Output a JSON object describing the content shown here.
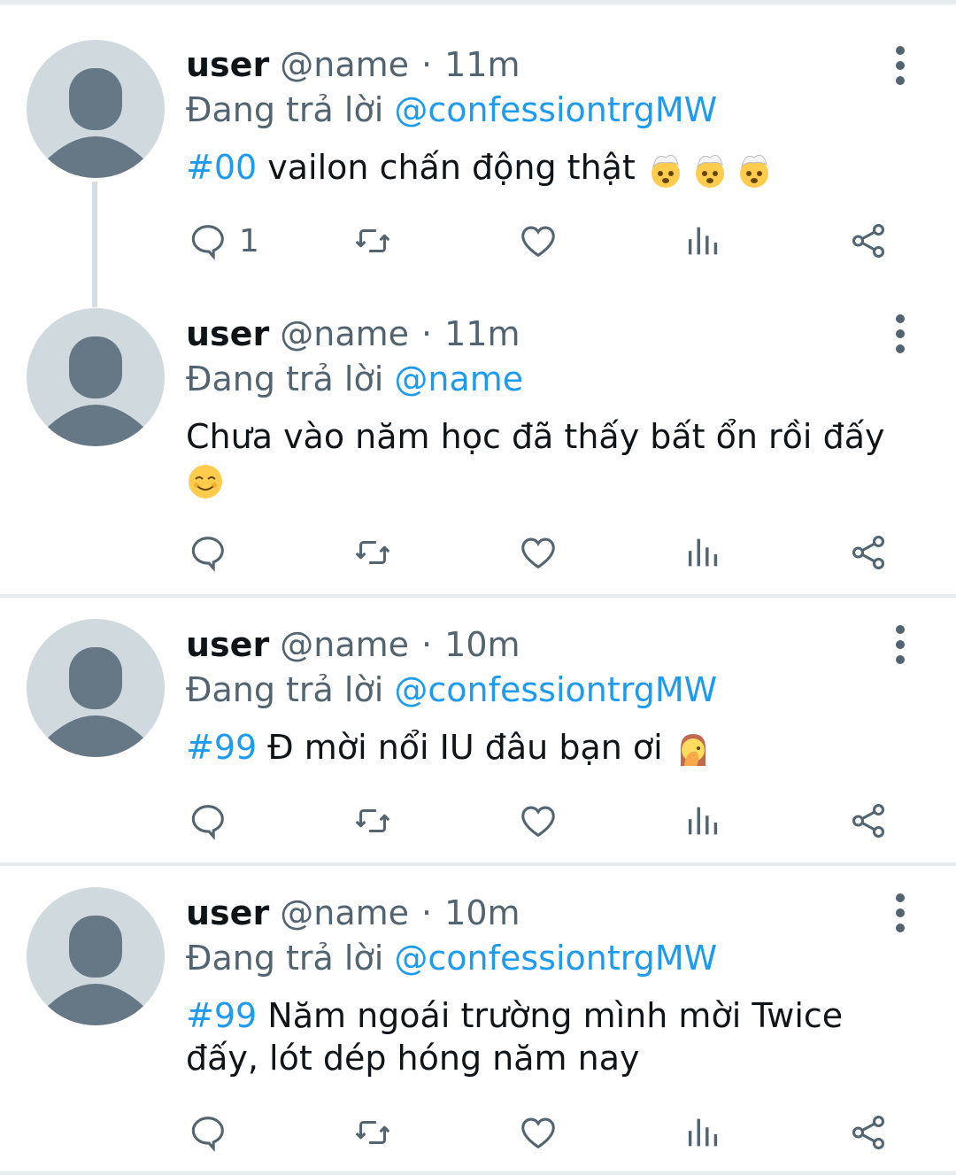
{
  "colors": {
    "accent": "#1d9bf0",
    "secondary_text": "#536471",
    "primary_text": "#0f1419",
    "avatar_bg": "#cfd9de",
    "avatar_fg": "#667786",
    "divider": "#e8ebed"
  },
  "icons": {
    "reply": "comment-bubble-icon",
    "retweet": "retweet-icon",
    "like": "heart-icon",
    "views": "bar-chart-icon",
    "share": "share-icon",
    "more": "vertical-dots-icon",
    "avatar": "default-avatar-icon"
  },
  "replying_prefix": "Đang trả lời",
  "tweets": [
    {
      "user": "user",
      "handle": "@name",
      "dot": "·",
      "time": "11m",
      "reply_to": "@confessiontrgMW",
      "hashtag": "#00",
      "text": " vailon chấn động thật ",
      "emojis": [
        "exploding-head-emoji",
        "exploding-head-emoji",
        "exploding-head-emoji"
      ],
      "reply_count": "1"
    },
    {
      "user": "user",
      "handle": "@name",
      "dot": "·",
      "time": "11m",
      "reply_to": "@name",
      "text": "Chưa vào năm học đã thấy bất ổn rồi đấy",
      "emojis": [
        "smiling-face-emoji"
      ],
      "reply_count": ""
    },
    {
      "user": "user",
      "handle": "@name",
      "dot": "·",
      "time": "10m",
      "reply_to": "@confessiontrgMW",
      "hashtag": "#99",
      "text": " Đ mời nổi IU đâu bạn ơi ",
      "emojis": [
        "facepalm-emoji"
      ],
      "reply_count": ""
    },
    {
      "user": "user",
      "handle": "@name",
      "dot": "·",
      "time": "10m",
      "reply_to": "@confessiontrgMW",
      "hashtag": "#99",
      "text": " Năm ngoái trường mình mời Twice đấy, lót dép hóng năm nay",
      "reply_count": ""
    }
  ]
}
